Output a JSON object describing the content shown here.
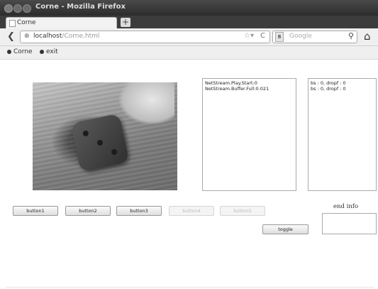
{
  "window": {
    "title": "Corne - Mozilla Firefox"
  },
  "tab": {
    "label": "Corne",
    "new_tab": "+"
  },
  "nav": {
    "back": "❮",
    "url_host": "localhost",
    "url_path": "/Corne.html",
    "search_placeholder": "Google",
    "search_engine": "8",
    "home": "⌂"
  },
  "bookmarks": [
    {
      "label": "Corne"
    },
    {
      "label": "exit"
    }
  ],
  "logs": {
    "stream": [
      "NetStream.Play.Start:0",
      "NetStream.Buffer.Full:0.021"
    ],
    "stats": [
      "bs : 0, dropf : 0",
      "bs : 0, dropf : 0"
    ]
  },
  "buttons": {
    "button1": "button1",
    "button2": "button2",
    "button3": "button3",
    "button4": "button4",
    "button5": "button5",
    "toggle": "toggle"
  },
  "end_info": {
    "label": "end info",
    "value": ""
  }
}
